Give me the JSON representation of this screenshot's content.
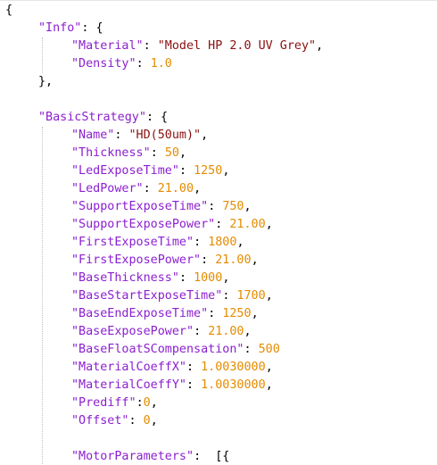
{
  "editor": {
    "lines": [
      {
        "indent": 0,
        "tokens": [
          {
            "t": "p",
            "v": "{"
          }
        ]
      },
      {
        "indent": 1,
        "tokens": [
          {
            "t": "k",
            "v": "\"Info\""
          },
          {
            "t": "p",
            "v": ": {"
          }
        ]
      },
      {
        "indent": 2,
        "tokens": [
          {
            "t": "k",
            "v": "\"Material\""
          },
          {
            "t": "p",
            "v": ": "
          },
          {
            "t": "s",
            "v": "\"Model HP 2.0 UV Grey\""
          },
          {
            "t": "p",
            "v": ","
          }
        ]
      },
      {
        "indent": 2,
        "tokens": [
          {
            "t": "k",
            "v": "\"Density\""
          },
          {
            "t": "p",
            "v": ": "
          },
          {
            "t": "n",
            "v": "1.0"
          }
        ]
      },
      {
        "indent": 1,
        "tokens": [
          {
            "t": "p",
            "v": "},"
          }
        ]
      },
      {
        "indent": 0,
        "tokens": []
      },
      {
        "indent": 1,
        "tokens": [
          {
            "t": "k",
            "v": "\"BasicStrategy\""
          },
          {
            "t": "p",
            "v": ": {"
          }
        ]
      },
      {
        "indent": 2,
        "tokens": [
          {
            "t": "k",
            "v": "\"Name\""
          },
          {
            "t": "p",
            "v": ": "
          },
          {
            "t": "s",
            "v": "\"HD(50um)\""
          },
          {
            "t": "p",
            "v": ","
          }
        ]
      },
      {
        "indent": 2,
        "tokens": [
          {
            "t": "k",
            "v": "\"Thickness\""
          },
          {
            "t": "p",
            "v": ": "
          },
          {
            "t": "n",
            "v": "50"
          },
          {
            "t": "p",
            "v": ","
          }
        ]
      },
      {
        "indent": 2,
        "tokens": [
          {
            "t": "k",
            "v": "\"LedExposeTime\""
          },
          {
            "t": "p",
            "v": ": "
          },
          {
            "t": "n",
            "v": "1250"
          },
          {
            "t": "p",
            "v": ","
          }
        ]
      },
      {
        "indent": 2,
        "tokens": [
          {
            "t": "k",
            "v": "\"LedPower\""
          },
          {
            "t": "p",
            "v": ": "
          },
          {
            "t": "n",
            "v": "21.00"
          },
          {
            "t": "p",
            "v": ","
          }
        ]
      },
      {
        "indent": 2,
        "tokens": [
          {
            "t": "k",
            "v": "\"SupportExposeTime\""
          },
          {
            "t": "p",
            "v": ": "
          },
          {
            "t": "n",
            "v": "750"
          },
          {
            "t": "p",
            "v": ","
          }
        ]
      },
      {
        "indent": 2,
        "tokens": [
          {
            "t": "k",
            "v": "\"SupportExposePower\""
          },
          {
            "t": "p",
            "v": ": "
          },
          {
            "t": "n",
            "v": "21.00"
          },
          {
            "t": "p",
            "v": ","
          }
        ]
      },
      {
        "indent": 2,
        "tokens": [
          {
            "t": "k",
            "v": "\"FirstExposeTime\""
          },
          {
            "t": "p",
            "v": ": "
          },
          {
            "t": "n",
            "v": "1800"
          },
          {
            "t": "p",
            "v": ","
          }
        ]
      },
      {
        "indent": 2,
        "tokens": [
          {
            "t": "k",
            "v": "\"FirstExposePower\""
          },
          {
            "t": "p",
            "v": ": "
          },
          {
            "t": "n",
            "v": "21.00"
          },
          {
            "t": "p",
            "v": ","
          }
        ]
      },
      {
        "indent": 2,
        "tokens": [
          {
            "t": "k",
            "v": "\"BaseThickness\""
          },
          {
            "t": "p",
            "v": ": "
          },
          {
            "t": "n",
            "v": "1000"
          },
          {
            "t": "p",
            "v": ","
          }
        ]
      },
      {
        "indent": 2,
        "tokens": [
          {
            "t": "k",
            "v": "\"BaseStartExposeTime\""
          },
          {
            "t": "p",
            "v": ": "
          },
          {
            "t": "n",
            "v": "1700"
          },
          {
            "t": "p",
            "v": ","
          }
        ]
      },
      {
        "indent": 2,
        "tokens": [
          {
            "t": "k",
            "v": "\"BaseEndExposeTime\""
          },
          {
            "t": "p",
            "v": ": "
          },
          {
            "t": "n",
            "v": "1250"
          },
          {
            "t": "p",
            "v": ","
          }
        ]
      },
      {
        "indent": 2,
        "tokens": [
          {
            "t": "k",
            "v": "\"BaseExposePower\""
          },
          {
            "t": "p",
            "v": ": "
          },
          {
            "t": "n",
            "v": "21.00"
          },
          {
            "t": "p",
            "v": ","
          }
        ]
      },
      {
        "indent": 2,
        "tokens": [
          {
            "t": "k",
            "v": "\"BaseFloatSCompensation\""
          },
          {
            "t": "p",
            "v": ": "
          },
          {
            "t": "n",
            "v": "500"
          }
        ]
      },
      {
        "indent": 2,
        "tokens": [
          {
            "t": "k",
            "v": "\"MaterialCoeffX\""
          },
          {
            "t": "p",
            "v": ": "
          },
          {
            "t": "n",
            "v": "1.0030000"
          },
          {
            "t": "p",
            "v": ","
          }
        ]
      },
      {
        "indent": 2,
        "tokens": [
          {
            "t": "k",
            "v": "\"MaterialCoeffY\""
          },
          {
            "t": "p",
            "v": ": "
          },
          {
            "t": "n",
            "v": "1.0030000"
          },
          {
            "t": "p",
            "v": ","
          }
        ]
      },
      {
        "indent": 2,
        "tokens": [
          {
            "t": "k",
            "v": "\"Prediff\""
          },
          {
            "t": "p",
            "v": ":"
          },
          {
            "t": "n",
            "v": "0"
          },
          {
            "t": "p",
            "v": ","
          }
        ]
      },
      {
        "indent": 2,
        "tokens": [
          {
            "t": "k",
            "v": "\"Offset\""
          },
          {
            "t": "p",
            "v": ": "
          },
          {
            "t": "n",
            "v": "0"
          },
          {
            "t": "p",
            "v": ","
          }
        ]
      },
      {
        "indent": 0,
        "tokens": []
      },
      {
        "indent": 2,
        "tokens": [
          {
            "t": "k",
            "v": "\"MotorParameters\""
          },
          {
            "t": "p",
            "v": ":  [{"
          }
        ]
      }
    ]
  },
  "colors": {
    "key": "#8b1fd0",
    "string": "#8b1010",
    "number": "#e58b00",
    "punctuation": "#000000",
    "indent_guide": "#bfbfbf"
  }
}
